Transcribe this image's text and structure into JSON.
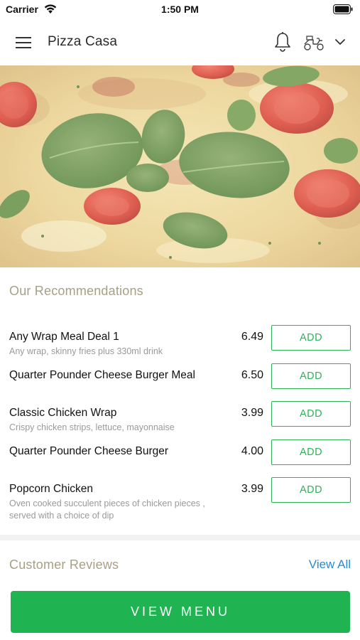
{
  "status_bar": {
    "carrier": "Carrier",
    "time": "1:50 PM"
  },
  "nav": {
    "title": "Pizza Casa",
    "icons": [
      "menu-icon",
      "bell-icon",
      "delivery-icon",
      "chevron-down-icon"
    ]
  },
  "recommendations": {
    "title": "Our Recommendations",
    "add_label": "ADD",
    "items": [
      {
        "name": "Any Wrap Meal Deal 1",
        "description": "Any wrap, skinny fries plus 330ml drink",
        "price": "6.49"
      },
      {
        "name": "Quarter Pounder Cheese Burger Meal",
        "description": "",
        "price": "6.50"
      },
      {
        "name": "Classic Chicken Wrap",
        "description": "Crispy chicken strips, lettuce, mayonnaise",
        "price": "3.99"
      },
      {
        "name": "Quarter Pounder Cheese Burger",
        "description": "",
        "price": "4.00"
      },
      {
        "name": "Popcorn Chicken",
        "description": "Oven cooked succulent pieces of chicken pieces , served with a choice of dip",
        "price": "3.99"
      }
    ]
  },
  "reviews": {
    "title": "Customer Reviews",
    "view_all": "View All"
  },
  "footer": {
    "view_menu": "VIEW MENU"
  },
  "colors": {
    "accent_green": "#1fb352",
    "section_title": "#a89f86",
    "link_blue": "#2a8bd1"
  }
}
